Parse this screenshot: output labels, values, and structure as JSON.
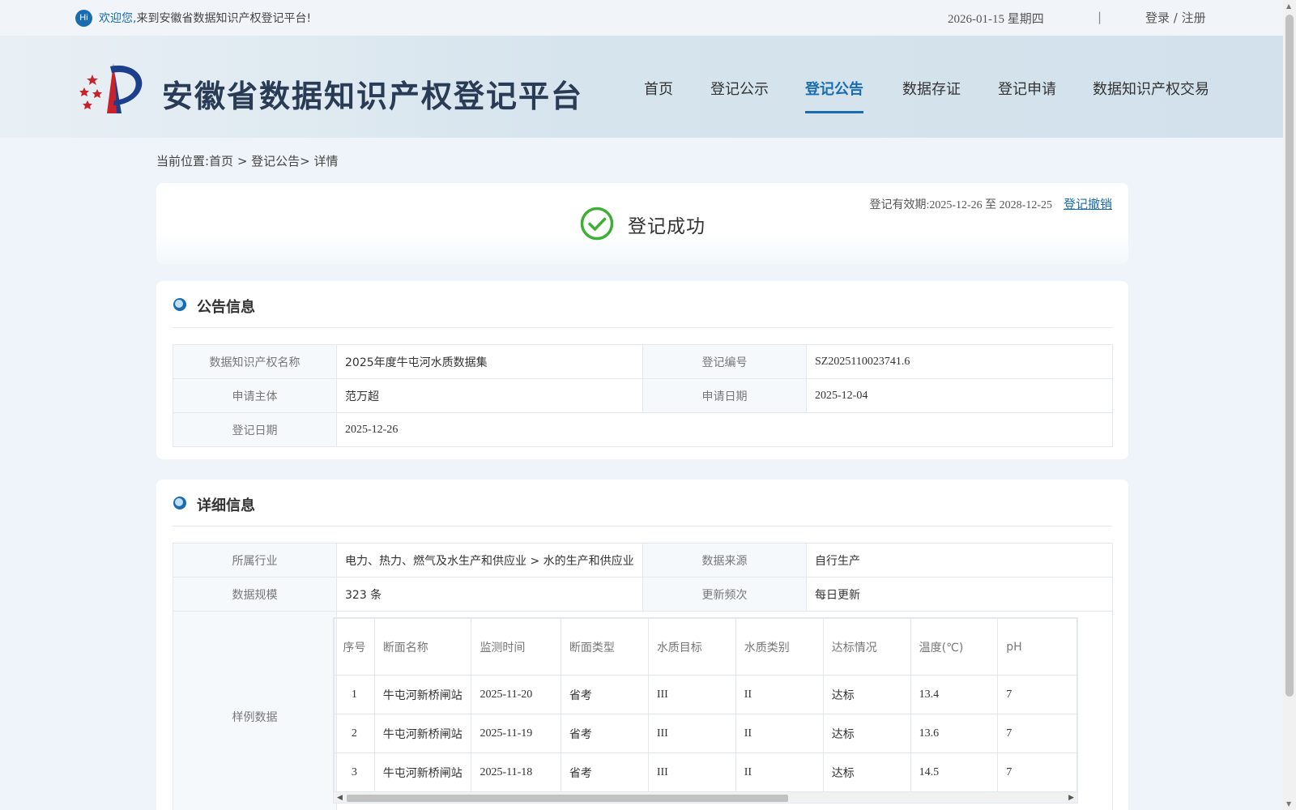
{
  "topbar": {
    "hi": "Hi",
    "welcome_emphasis": "欢迎您,",
    "welcome_rest": "来到安徽省数据知识产权登记平台!",
    "date": "2026-01-15 星期四",
    "separator": "|",
    "login": "登录",
    "slash": "/",
    "register": "注册"
  },
  "header": {
    "title": "安徽省数据知识产权登记平台",
    "nav": [
      {
        "label": "首页"
      },
      {
        "label": "登记公示"
      },
      {
        "label": "登记公告",
        "active": true
      },
      {
        "label": "数据存证"
      },
      {
        "label": "登记申请"
      },
      {
        "label": "数据知识产权交易"
      }
    ],
    "accent_color": "#1a6cb0"
  },
  "breadcrumb": {
    "text": "当前位置:首页 > 登记公告> 详情"
  },
  "status": {
    "validity_label": "登记有效期:",
    "validity_range": "2025-12-26 至 2028-12-25",
    "revoke_label": "登记撤销",
    "result": "登记成功",
    "success_color": "#3cb035"
  },
  "announcement": {
    "title": "公告信息",
    "rows": [
      {
        "l1": "数据知识产权名称",
        "v1": "2025年度牛屯河水质数据集",
        "l2": "登记编号",
        "v2": "SZ2025110023741.6"
      },
      {
        "l1": "申请主体",
        "v1": "范万超",
        "l2": "申请日期",
        "v2": "2025-12-04"
      },
      {
        "l1": "登记日期",
        "v1": "2025-12-26"
      }
    ]
  },
  "detail": {
    "title": "详细信息",
    "rows": [
      {
        "l1": "所属行业",
        "v1": "电力、热力、燃气及水生产和供应业 > 水的生产和供应业",
        "l2": "数据来源",
        "v2": "自行生产"
      },
      {
        "l1": "数据规模",
        "v1": "323 条",
        "l2": "更新频次",
        "v2": "每日更新"
      }
    ],
    "sample_label": "样例数据",
    "sample": {
      "headers": [
        "序号",
        "断面名称",
        "监测时间",
        "断面类型",
        "水质目标",
        "水质类别",
        "达标情况",
        "温度(℃)",
        "pH"
      ],
      "rows": [
        [
          "1",
          "牛屯河新桥闸站",
          "2025-11-20",
          "省考",
          "III",
          "II",
          "达标",
          "13.4",
          "7"
        ],
        [
          "2",
          "牛屯河新桥闸站",
          "2025-11-19",
          "省考",
          "III",
          "II",
          "达标",
          "13.6",
          "7"
        ],
        [
          "3",
          "牛屯河新桥闸站",
          "2025-11-18",
          "省考",
          "III",
          "II",
          "达标",
          "14.5",
          "7"
        ]
      ]
    }
  }
}
